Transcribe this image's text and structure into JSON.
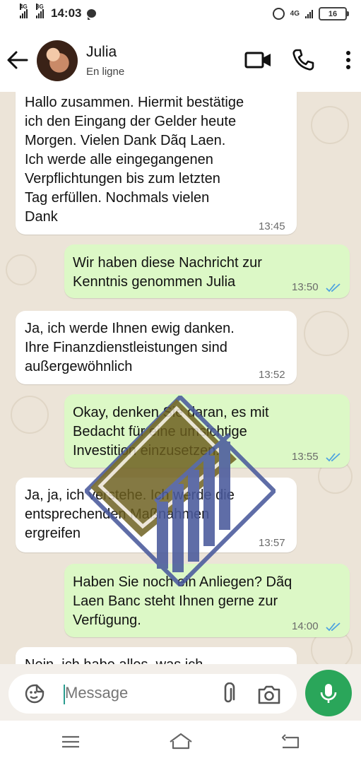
{
  "status_bar": {
    "network_left_1": "4G",
    "network_left_2": "3G",
    "time": "14:03",
    "network_right": "4G",
    "battery": "16"
  },
  "header": {
    "contact_name": "Julia",
    "status": "En ligne"
  },
  "messages": [
    {
      "direction": "in",
      "text": "Hallo zusammen. Hiermit bestätige\nich den Eingang der Gelder heute\nMorgen. Vielen Dank Dãq Laen.\nIch werde alle eingegangenen\nVerpflichtungen bis zum letzten\nTag erfüllen. Nochmals vielen\nDank",
      "time": "13:45"
    },
    {
      "direction": "out",
      "text": "Wir haben diese Nachricht zur\nKenntnis genommen Julia",
      "time": "13:50",
      "read": true
    },
    {
      "direction": "in",
      "text": "Ja, ich werde Ihnen ewig danken.\nIhre Finanzdienstleistungen sind\naußergewöhnlich",
      "time": "13:52"
    },
    {
      "direction": "out",
      "text": "Okay, denken Sie daran, es mit\nBedacht für eine umsichtige\nInvestition einzusetzen.",
      "time": "13:55",
      "read": true
    },
    {
      "direction": "in",
      "text": "Ja, ja, ich verstehe. Ich werde die\nentsprechenden Maßnahmen\nergreifen",
      "time": "13:57"
    },
    {
      "direction": "out",
      "text": "Haben Sie noch ein Anliegen? Dãq\nLaen Banc steht Ihnen gerne zur\nVerfügung.",
      "time": "14:00",
      "read": true
    },
    {
      "direction": "in",
      "text": "Nein, ich habe alles, was ich",
      "time": ""
    }
  ],
  "input": {
    "placeholder": "Message"
  },
  "icons": {
    "back": "arrow-left-icon",
    "video": "video-camera-icon",
    "call": "phone-icon",
    "menu": "more-vertical-icon",
    "emoji": "sticker-icon",
    "attach": "paperclip-icon",
    "camera": "camera-icon",
    "mic": "microphone-icon"
  },
  "colors": {
    "incoming_bubble": "#ffffff",
    "outgoing_bubble": "#dcf8c6",
    "read_ticks": "#4fa3e0",
    "mic_button": "#2aa65a",
    "watermark_olive": "#6b5e1e",
    "watermark_blue": "#4a5a9c"
  }
}
